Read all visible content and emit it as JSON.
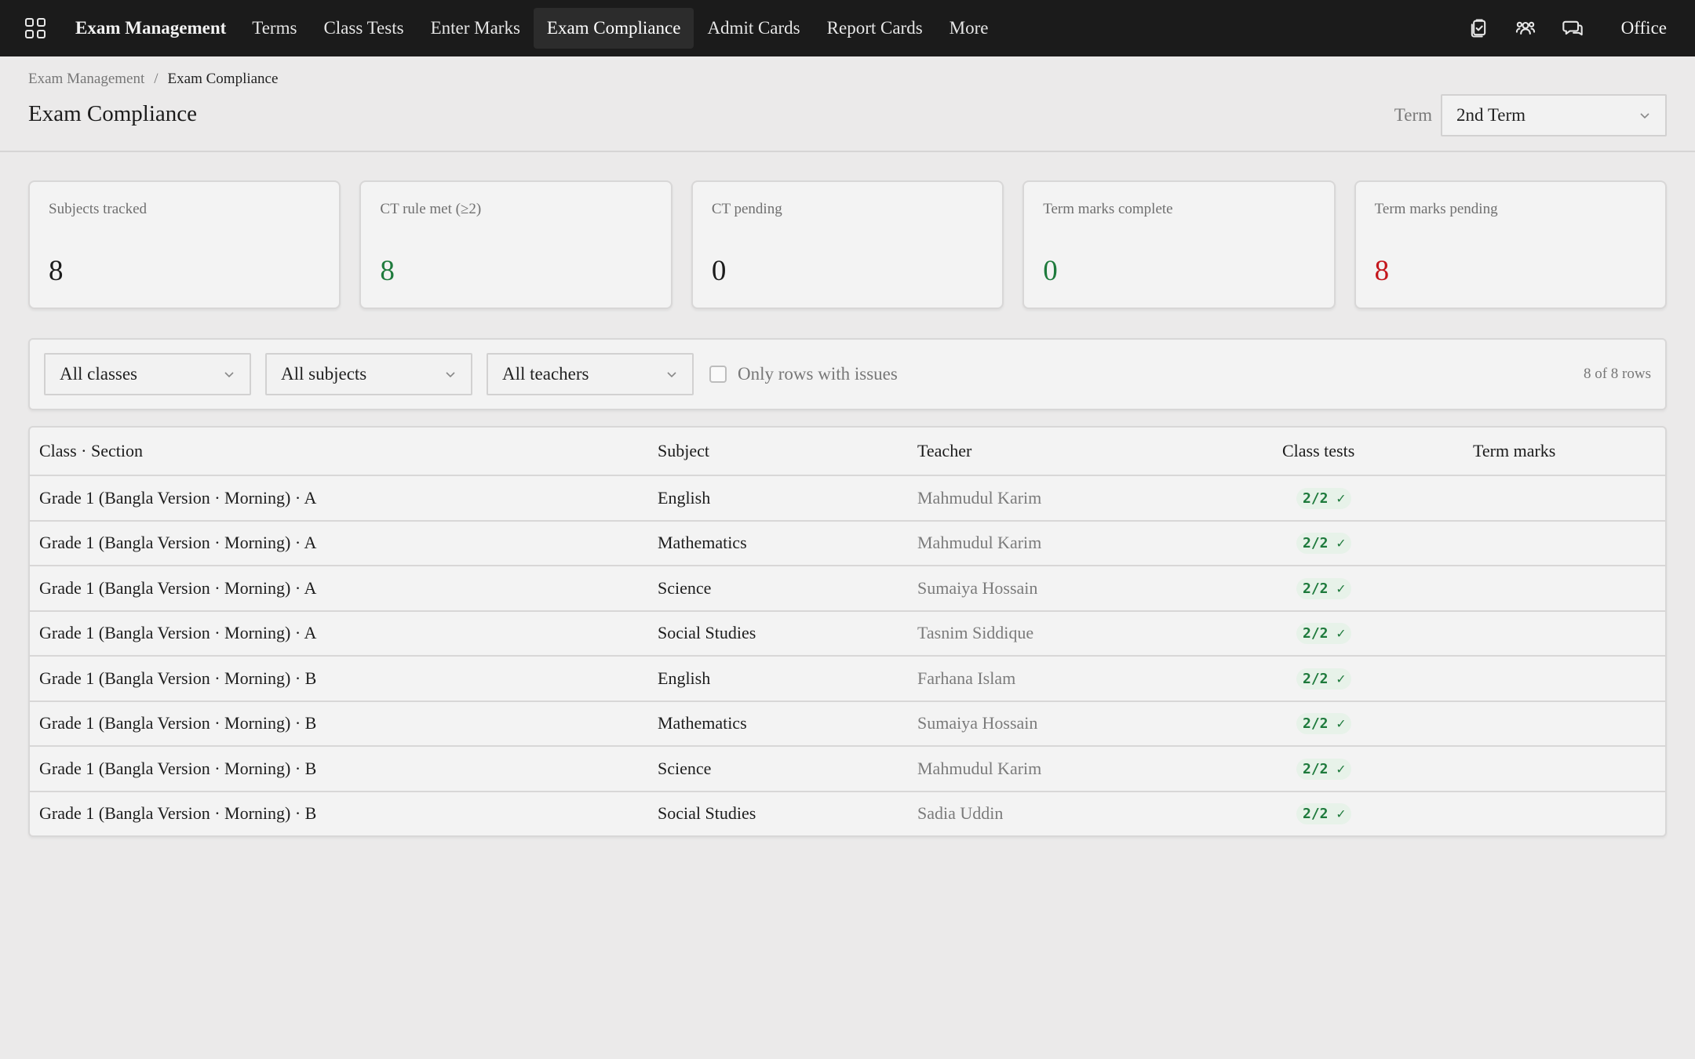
{
  "nav": {
    "brand": "Exam Management",
    "links": [
      "Terms",
      "Class Tests",
      "Enter Marks",
      "Exam Compliance",
      "Admit Cards",
      "Report Cards",
      "More"
    ],
    "active": "Exam Compliance",
    "icons": [
      "clipboard-check-icon",
      "users-icon",
      "chat-icon"
    ],
    "office": "Office"
  },
  "breadcrumb": {
    "parent": "Exam Management",
    "separator": "/",
    "current": "Exam Compliance"
  },
  "header": {
    "title": "Exam Compliance",
    "term_label": "Term",
    "term_value": "2nd Term"
  },
  "stats": [
    {
      "label": "Subjects tracked",
      "value": "8",
      "color": "#1b1b1b"
    },
    {
      "label": "CT rule met (≥2)",
      "value": "8",
      "color": "#1e7a3c"
    },
    {
      "label": "CT pending",
      "value": "0",
      "color": "#1b1b1b"
    },
    {
      "label": "Term marks complete",
      "value": "0",
      "color": "#1e7a3c"
    },
    {
      "label": "Term marks pending",
      "value": "8",
      "color": "#c4161c"
    }
  ],
  "filters": {
    "class": "All classes",
    "subject": "All subjects",
    "teacher": "All teachers",
    "issues_label": "Only rows with issues",
    "row_count": "8 of 8 rows"
  },
  "table": {
    "headers": [
      "Class · Section",
      "Subject",
      "Teacher",
      "Class tests",
      "Term marks"
    ],
    "rows": [
      {
        "class": "Grade 1 (Bangla Version · Morning) · A",
        "subject": "English",
        "teacher": "Mahmudul Karim",
        "ct": "2/2 ✓",
        "term": ""
      },
      {
        "class": "Grade 1 (Bangla Version · Morning) · A",
        "subject": "Mathematics",
        "teacher": "Mahmudul Karim",
        "ct": "2/2 ✓",
        "term": ""
      },
      {
        "class": "Grade 1 (Bangla Version · Morning) · A",
        "subject": "Science",
        "teacher": "Sumaiya Hossain",
        "ct": "2/2 ✓",
        "term": ""
      },
      {
        "class": "Grade 1 (Bangla Version · Morning) · A",
        "subject": "Social Studies",
        "teacher": "Tasnim Siddique",
        "ct": "2/2 ✓",
        "term": ""
      },
      {
        "class": "Grade 1 (Bangla Version · Morning) · B",
        "subject": "English",
        "teacher": "Farhana Islam",
        "ct": "2/2 ✓",
        "term": ""
      },
      {
        "class": "Grade 1 (Bangla Version · Morning) · B",
        "subject": "Mathematics",
        "teacher": "Sumaiya Hossain",
        "ct": "2/2 ✓",
        "term": ""
      },
      {
        "class": "Grade 1 (Bangla Version · Morning) · B",
        "subject": "Science",
        "teacher": "Mahmudul Karim",
        "ct": "2/2 ✓",
        "term": ""
      },
      {
        "class": "Grade 1 (Bangla Version · Morning) · B",
        "subject": "Social Studies",
        "teacher": "Sadia Uddin",
        "ct": "2/2 ✓",
        "term": ""
      }
    ]
  }
}
